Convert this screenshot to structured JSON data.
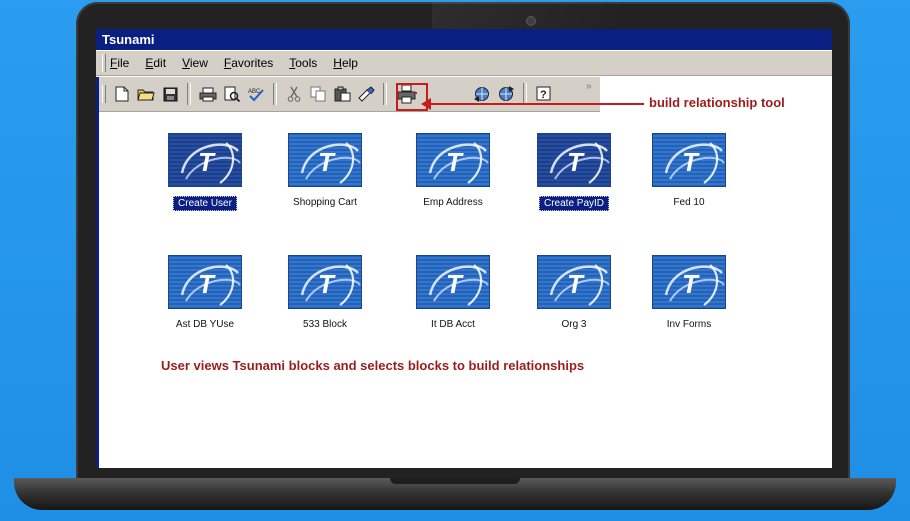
{
  "window": {
    "title": "Tsunami"
  },
  "menu": {
    "items": [
      {
        "mnemonic": "F",
        "rest": "ile"
      },
      {
        "mnemonic": "E",
        "rest": "dit"
      },
      {
        "mnemonic": "V",
        "rest": "iew"
      },
      {
        "mnemonic": "F",
        "rest": "avorites",
        "prefix": ""
      },
      {
        "mnemonic": "T",
        "rest": "ools"
      },
      {
        "mnemonic": "H",
        "rest": "elp"
      }
    ]
  },
  "toolbar": {
    "icons": [
      "new-document-icon",
      "open-folder-icon",
      "save-icon",
      "print-icon",
      "print-preview-icon",
      "spellcheck-icon",
      "cut-icon",
      "copy-icon",
      "paste-icon",
      "format-painter-icon",
      "build-relationship-icon",
      "globe-back-icon",
      "globe-forward-icon",
      "help-icon"
    ]
  },
  "annotations": {
    "tool_label": "build relationship tool",
    "caption": "User views Tsunami blocks and selects blocks to build relationships"
  },
  "blocks": [
    {
      "label": "Create User",
      "selected": true
    },
    {
      "label": "Shopping Cart",
      "selected": false
    },
    {
      "label": "Emp Address",
      "selected": false
    },
    {
      "label": "Create PayID",
      "selected": true
    },
    {
      "label": "Fed 10",
      "selected": false
    },
    {
      "label": "Ast DB YUse",
      "selected": false
    },
    {
      "label": "533 Block",
      "selected": false
    },
    {
      "label": "It DB Acct",
      "selected": false
    },
    {
      "label": "Org 3",
      "selected": false
    },
    {
      "label": "Inv Forms",
      "selected": false
    }
  ],
  "block_logo_letter": "T",
  "colors": {
    "titlebar": "#0a1f82",
    "annotation": "#9b1c1c",
    "background": "#1f8fe6"
  }
}
